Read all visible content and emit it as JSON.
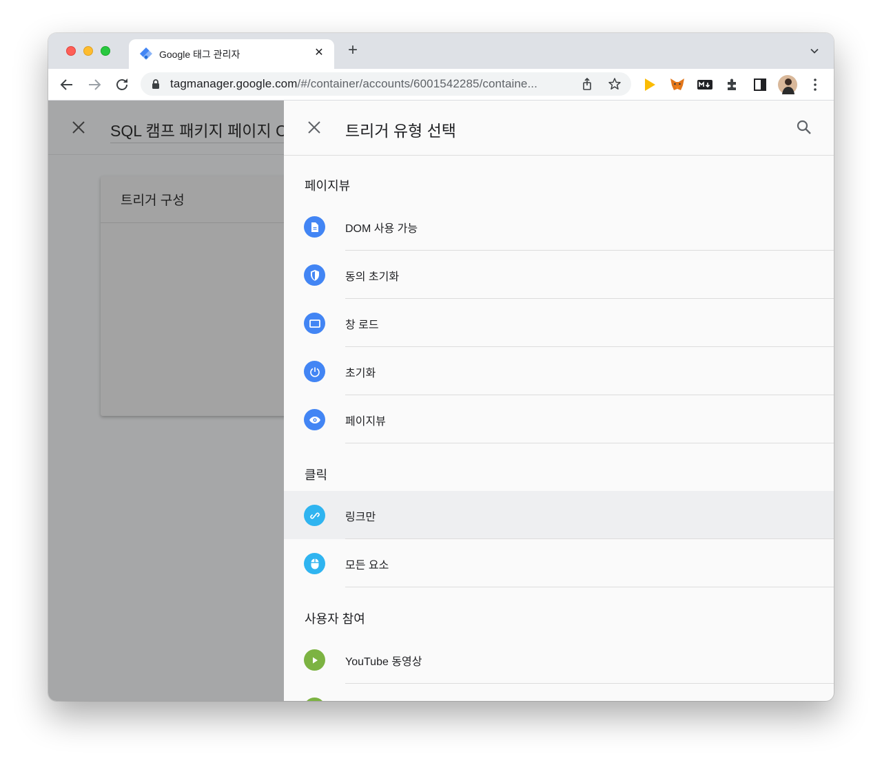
{
  "browser": {
    "tab_title": "Google 태그 관리자",
    "tab_close": "✕",
    "new_tab": "+",
    "url_host": "tagmanager.google.com",
    "url_path": "/#/container/accounts/6001542285/containe..."
  },
  "background": {
    "title": "SQL 캠프 패키지 페이지 C",
    "card_title": "트리거 구성"
  },
  "panel": {
    "title": "트리거 유형 선택",
    "sections": [
      {
        "label": "페이지뷰",
        "items": [
          {
            "label": "DOM 사용 가능",
            "icon": "document-icon",
            "color": "#4285f4"
          },
          {
            "label": "동의 초기화",
            "icon": "shield-icon",
            "color": "#4285f4"
          },
          {
            "label": "창 로드",
            "icon": "window-icon",
            "color": "#4285f4"
          },
          {
            "label": "초기화",
            "icon": "power-icon",
            "color": "#4285f4"
          },
          {
            "label": "페이지뷰",
            "icon": "eye-icon",
            "color": "#4285f4"
          }
        ]
      },
      {
        "label": "클릭",
        "items": [
          {
            "label": "링크만",
            "icon": "link-icon",
            "color": "#2fb4f0",
            "active": true
          },
          {
            "label": "모든 요소",
            "icon": "mouse-icon",
            "color": "#2fb4f0"
          }
        ]
      },
      {
        "label": "사용자 참여",
        "items": [
          {
            "label": "YouTube 동영상",
            "icon": "play-icon",
            "color": "#7cb342"
          }
        ]
      }
    ]
  }
}
